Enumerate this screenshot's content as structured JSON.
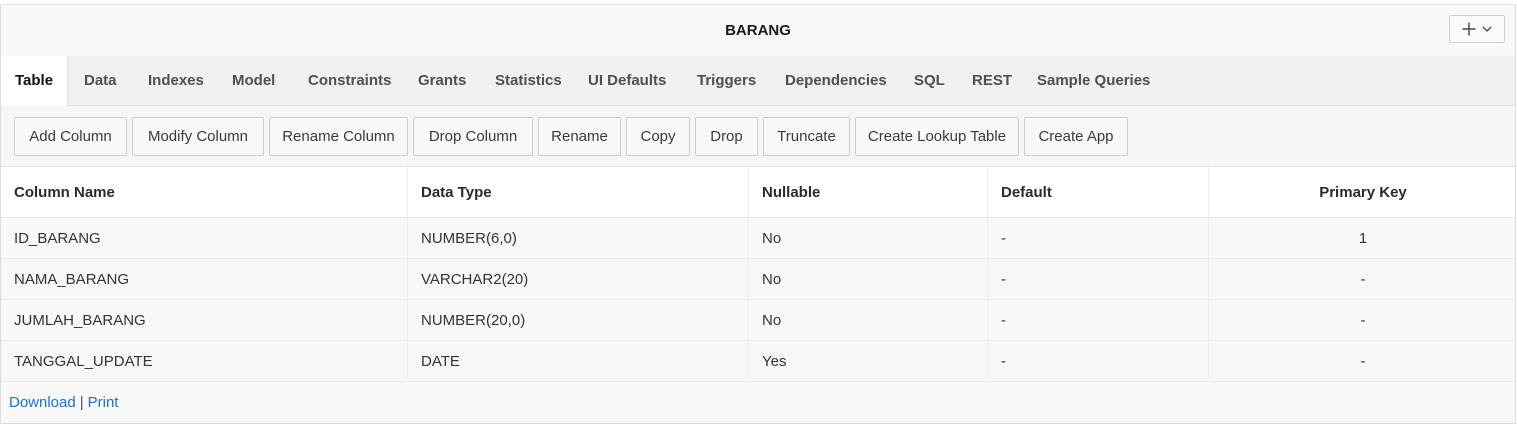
{
  "header": {
    "title": "BARANG",
    "add_menu_icon": "plus-icon",
    "add_menu_caret": "chevron-down-icon"
  },
  "tabs": [
    {
      "label": "Table",
      "active": true
    },
    {
      "label": "Data"
    },
    {
      "label": "Indexes"
    },
    {
      "label": "Model"
    },
    {
      "label": "Constraints"
    },
    {
      "label": "Grants"
    },
    {
      "label": "Statistics"
    },
    {
      "label": "UI Defaults"
    },
    {
      "label": "Triggers"
    },
    {
      "label": "Dependencies"
    },
    {
      "label": "SQL"
    },
    {
      "label": "REST"
    },
    {
      "label": "Sample Queries"
    }
  ],
  "toolbar": {
    "buttons": [
      "Add Column",
      "Modify Column",
      "Rename Column",
      "Drop Column",
      "Rename",
      "Copy",
      "Drop",
      "Truncate",
      "Create Lookup Table",
      "Create App"
    ]
  },
  "table": {
    "headers": [
      "Column Name",
      "Data Type",
      "Nullable",
      "Default",
      "Primary Key"
    ],
    "rows": [
      [
        "ID_BARANG",
        "NUMBER(6,0)",
        "No",
        "-",
        "1"
      ],
      [
        "NAMA_BARANG",
        "VARCHAR2(20)",
        "No",
        "-",
        "-"
      ],
      [
        "JUMLAH_BARANG",
        "NUMBER(20,0)",
        "No",
        "-",
        "-"
      ],
      [
        "TANGGAL_UPDATE",
        "DATE",
        "Yes",
        "-",
        "-"
      ]
    ]
  },
  "footer": {
    "download_label": "Download",
    "separator": "|",
    "print_label": "Print"
  },
  "colors": {
    "link": "#1a72c7",
    "active_tab_bg": "#ffffff",
    "tab_bar_bg": "#f1f1f1"
  }
}
